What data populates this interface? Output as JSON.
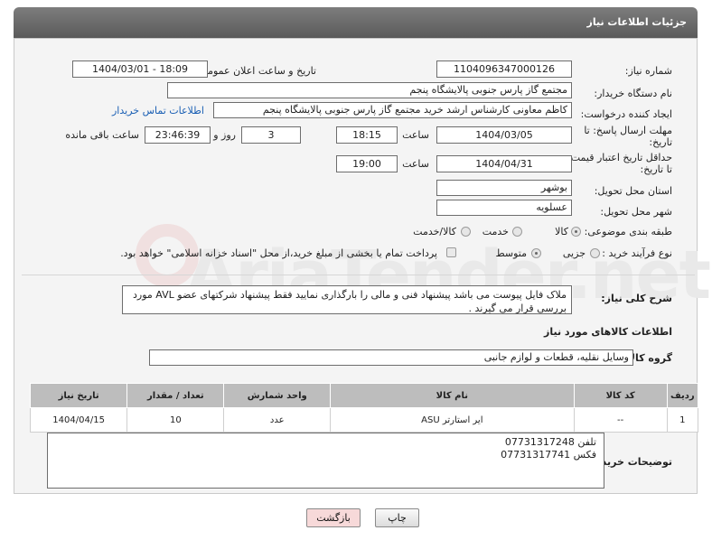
{
  "header": {
    "title": "جزئیات اطلاعات نیاز"
  },
  "watermark": {
    "text": "AriaTender.net"
  },
  "fields": {
    "need_number_label": "شماره نیاز:",
    "need_number": "1104096347000126",
    "announce_label": "تاریخ و ساعت اعلان عمومی:",
    "announce_value": "1404/03/01 - 18:09",
    "buyer_org_label": "نام دستگاه خریدار:",
    "buyer_org": "مجتمع گاز پارس جنوبی  پالایشگاه پنجم",
    "requester_label": "ایجاد کننده درخواست:",
    "requester": "کاظم معاونی کارشناس ارشد خرید مجتمع گاز پارس جنوبی  پالایشگاه پنجم",
    "buyer_contact_link": "اطلاعات تماس خریدار",
    "deadline_label_1": "مهلت ارسال پاسخ: تا",
    "deadline_label_2": "تاریخ:",
    "deadline_date": "1404/03/05",
    "time_label": "ساعت",
    "deadline_time": "18:15",
    "days_value": "3",
    "days_label": "روز و",
    "remaining_time": "23:46:39",
    "remaining_label": "ساعت باقی مانده",
    "validity_label_1": "حداقل تاریخ اعتبار قیمت:",
    "validity_label_2": "تا تاریخ:",
    "validity_date": "1404/04/31",
    "validity_time_label": "ساعت",
    "validity_time": "19:00",
    "province_label": "استان محل تحویل:",
    "province": "بوشهر",
    "city_label": "شهر محل تحویل:",
    "city": "عسلویه",
    "category_label": "طبقه بندی موضوعی:",
    "category_options": [
      "کالا",
      "خدمت",
      "کالا/خدمت"
    ],
    "category_selected": "کالا",
    "process_label": "نوع فرآیند خرید :",
    "process_options": [
      "جزیی",
      "متوسط"
    ],
    "process_selected": "متوسط",
    "payment_note": "پرداخت تمام یا بخشی از مبلغ خرید،از محل \"اسناد خزانه اسلامی\" خواهد بود."
  },
  "description": {
    "label": "شرح کلی نیاز:",
    "text": "ملاک فایل پیوست می باشد پیشنهاد فنی و مالی را بارگذاری نمایید فقط پیشنهاد شرکتهای عضو AVL مورد بررسی قرار می گیرند ."
  },
  "goods_info": {
    "section_title": "اطلاعات کالاهای مورد نیاز",
    "group_label": "گروه کالا:",
    "group_value": "وسایل نقلیه، قطعات و لوازم جانبی"
  },
  "items_table": {
    "columns": [
      "ردیف",
      "کد کالا",
      "نام کالا",
      "واحد شمارش",
      "تعداد / مقدار",
      "تاریخ نیاز"
    ],
    "rows": [
      [
        "1",
        "--",
        "ایر استارتر ASU",
        "عدد",
        "10",
        "1404/04/15"
      ]
    ]
  },
  "buyer_notes": {
    "label": "توضیحات خریدار:",
    "line1": "تلفن 07731317248",
    "line2": "فکس 07731317741"
  },
  "buttons": {
    "print": "چاپ",
    "back": "بازگشت"
  },
  "colors": {
    "header_bg": "#6b6b6b",
    "link": "#1a5fb4",
    "back_button_bg": "#f7d9d9",
    "table_header_bg": "#bdbdbd"
  }
}
